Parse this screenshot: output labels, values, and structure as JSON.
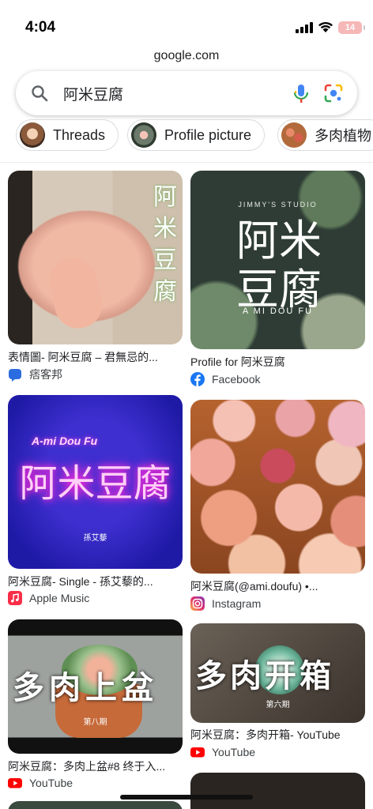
{
  "status_bar": {
    "time": "4:04",
    "battery": "14"
  },
  "url": "google.com",
  "search": {
    "query": "阿米豆腐"
  },
  "chips": [
    {
      "label": "Threads"
    },
    {
      "label": "Profile picture"
    },
    {
      "label": "多肉植物"
    }
  ],
  "results": [
    {
      "title": "表情圖- 阿米豆腐 – 君無忌的...",
      "source": "痞客邦",
      "overlay": "阿米豆腐"
    },
    {
      "title": "Profile for 阿米豆腐",
      "source": "Facebook",
      "overlay_top": "JIMMY'S STUDIO",
      "overlay": "阿米豆腐",
      "overlay_bottom": "A MI DOU FU"
    },
    {
      "title": "阿米豆腐- Single - 孫艾藜的...",
      "source": "Apple Music",
      "overlay_script": "A-mi Dou Fu",
      "overlay": "阿米豆腐",
      "overlay_small": "孫艾藜"
    },
    {
      "title": "阿米豆腐(@ami.doufu) •...",
      "source": "Instagram"
    },
    {
      "title": "阿米豆腐：多肉上盆#8 终于入...",
      "source": "YouTube",
      "overlay": "多肉上盆",
      "overlay_small": "第八期"
    },
    {
      "title": "阿米豆腐：多肉开箱- YouTube",
      "source": "YouTube",
      "overlay": "多肉开箱",
      "overlay_small": "第六期"
    }
  ],
  "colors": {
    "youtube": "#ff0000",
    "facebook": "#1877f2",
    "pixnet": "#2b6de0",
    "apple_music": "#fa2d48"
  }
}
